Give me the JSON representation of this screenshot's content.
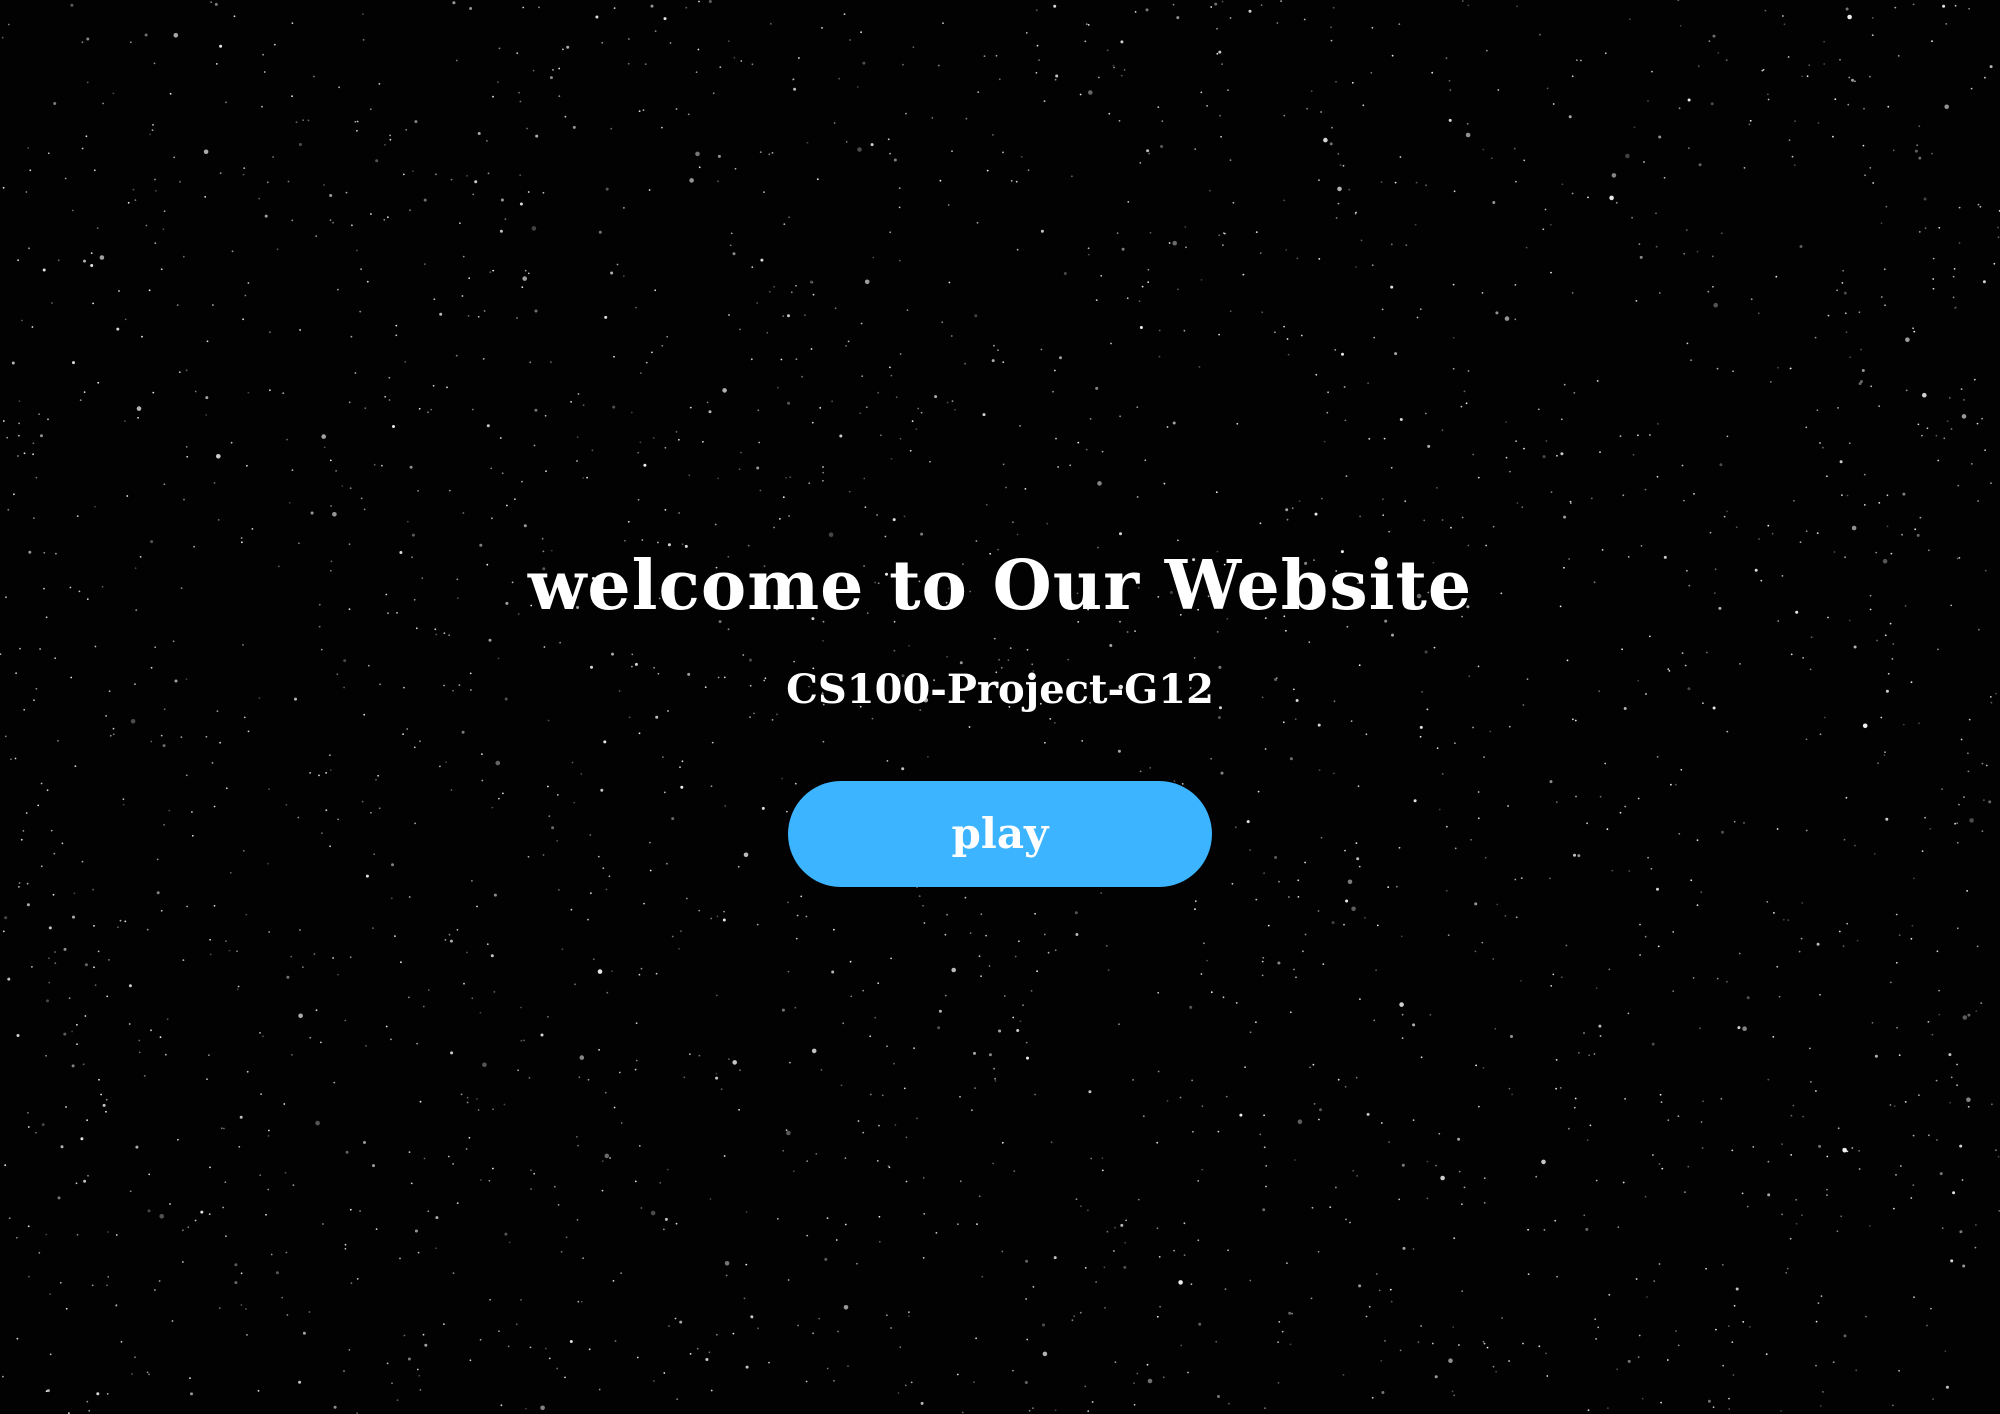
{
  "hero": {
    "title": "welcome to Our Website",
    "subtitle": "CS100-Project-G12",
    "play_label": "play"
  },
  "colors": {
    "background": "#020202",
    "text": "#ffffff",
    "accent": "#3cb4ff"
  }
}
